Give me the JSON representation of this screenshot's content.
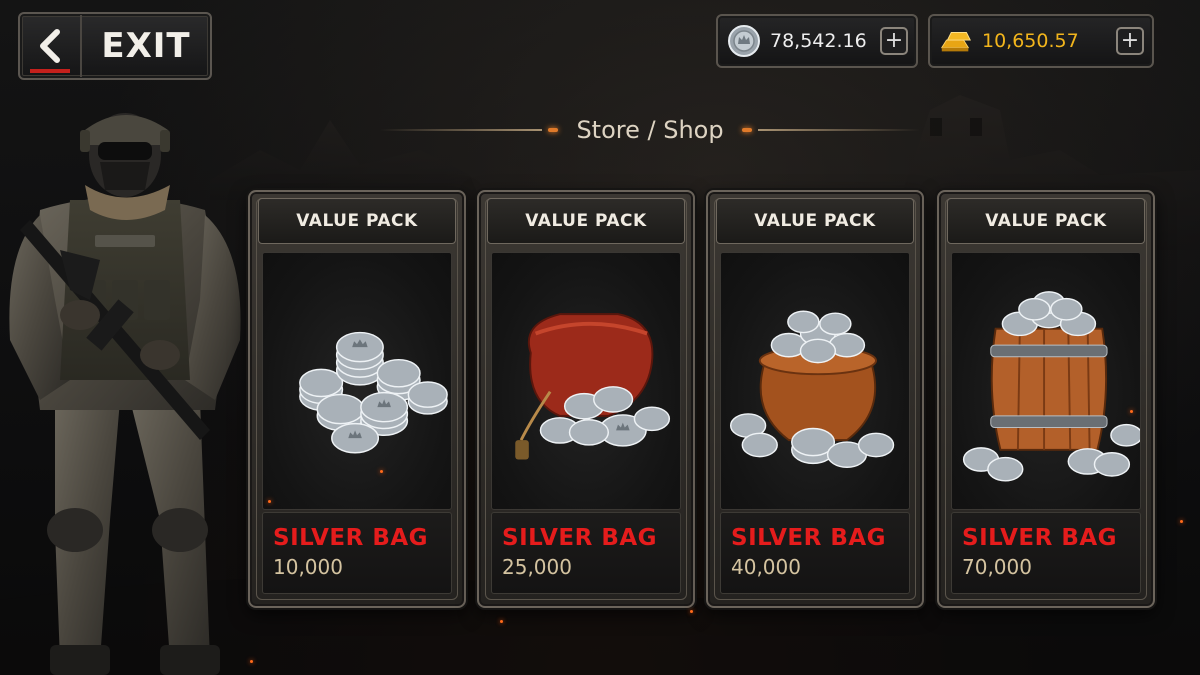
{
  "header": {
    "exit_label": "EXIT",
    "title": "Store / Shop"
  },
  "currencies": {
    "silver": {
      "value": "78,542.16",
      "icon": "silver-coin-icon",
      "color": "#eeeeee"
    },
    "gold": {
      "value": "10,650.57",
      "icon": "gold-bars-icon",
      "color": "#f2b51c"
    },
    "plus_label": "+"
  },
  "cards": [
    {
      "header": "VALUE PACK",
      "name": "SILVER BAG",
      "amount": "10,000",
      "art": "silver-coin-stack-icon"
    },
    {
      "header": "VALUE PACK",
      "name": "SILVER BAG",
      "amount": "25,000",
      "art": "coin-sack-icon"
    },
    {
      "header": "VALUE PACK",
      "name": "SILVER BAG",
      "amount": "40,000",
      "art": "coin-pot-icon"
    },
    {
      "header": "VALUE PACK",
      "name": "SILVER BAG",
      "amount": "70,000",
      "art": "coin-barrel-icon"
    }
  ],
  "colors": {
    "accent_red": "#e51c1c",
    "amount_tan": "#d4c3a0",
    "gold": "#f2b51c"
  }
}
